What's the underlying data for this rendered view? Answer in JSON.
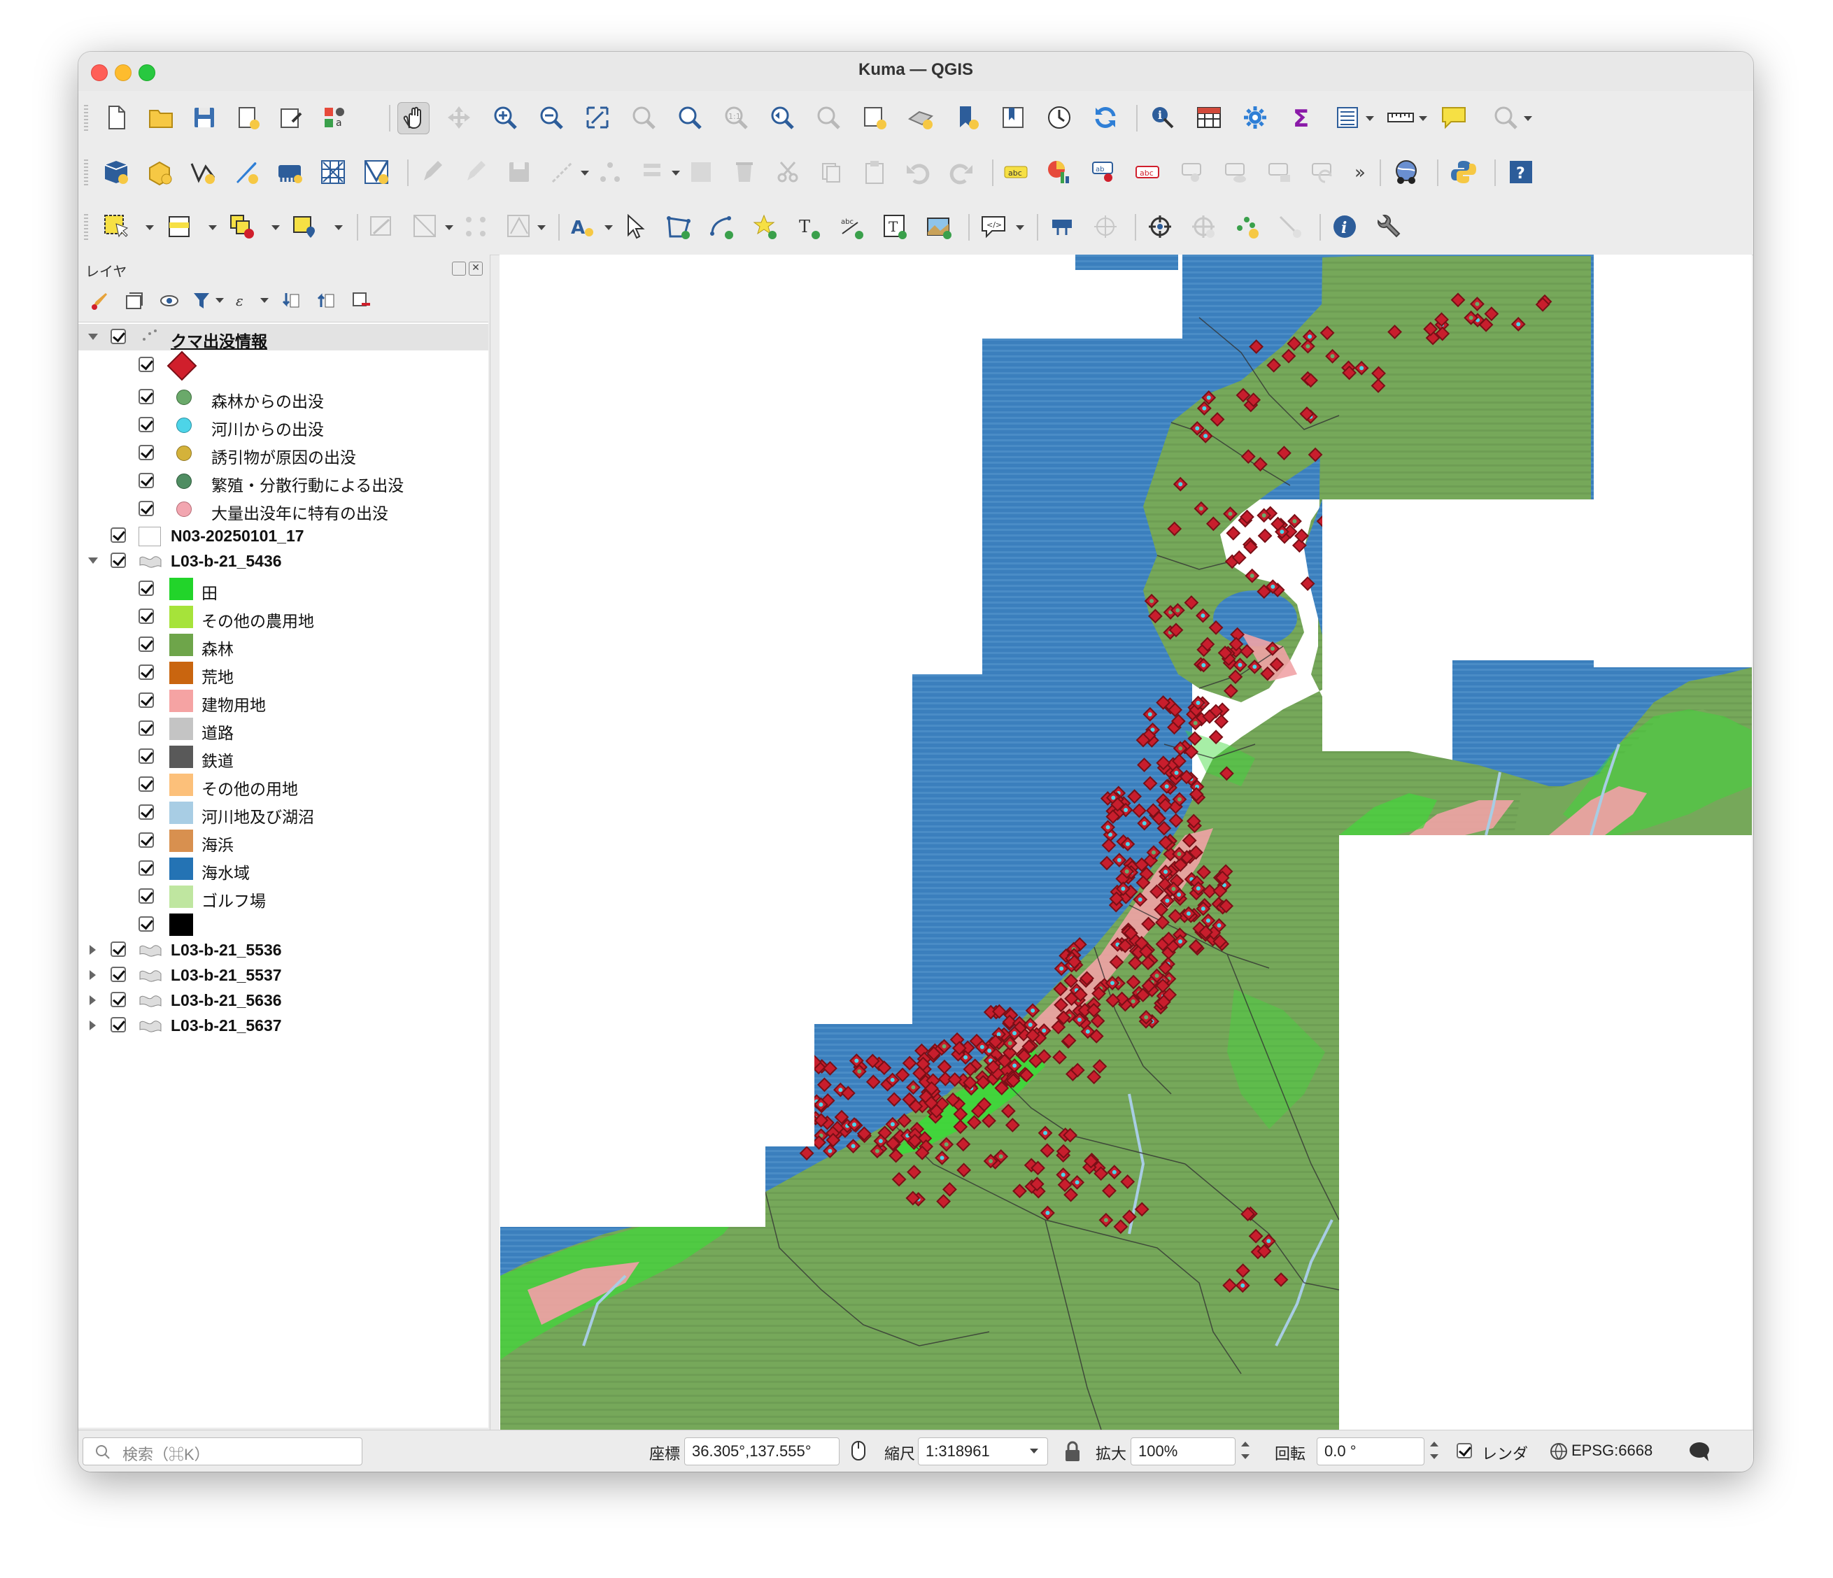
{
  "window": {
    "title": "Kuma — QGIS"
  },
  "panel": {
    "title": "レイヤ",
    "layers": [
      {
        "name": "クマ出没情報",
        "expanded": true,
        "selected": true
      },
      {
        "name": "N03-20250101_17",
        "expanded": false
      },
      {
        "name": "L03-b-21_5436",
        "expanded": true
      },
      {
        "name": "L03-b-21_5536",
        "expanded": false
      },
      {
        "name": "L03-b-21_5537",
        "expanded": false
      },
      {
        "name": "L03-b-21_5636",
        "expanded": false
      },
      {
        "name": "L03-b-21_5637",
        "expanded": false
      }
    ],
    "bear_legend": [
      {
        "label": "",
        "color": "#d01f2c",
        "shape": "diamond"
      },
      {
        "label": "森林からの出没",
        "color": "#6aa96a"
      },
      {
        "label": "河川からの出没",
        "color": "#4dd4e8"
      },
      {
        "label": "誘引物が原因の出没",
        "color": "#d4b23a"
      },
      {
        "label": "繁殖・分散行動による出没",
        "color": "#4f8d62"
      },
      {
        "label": "大量出没年に特有の出没",
        "color": "#f2a6b0"
      }
    ],
    "landuse_legend": [
      {
        "label": "田",
        "color": "#22d42a"
      },
      {
        "label": "その他の農用地",
        "color": "#a6e33a"
      },
      {
        "label": "森林",
        "color": "#6ea54a"
      },
      {
        "label": "荒地",
        "color": "#c9650f"
      },
      {
        "label": "建物用地",
        "color": "#f5a3a3"
      },
      {
        "label": "道路",
        "color": "#c4c4c4"
      },
      {
        "label": "鉄道",
        "color": "#595959"
      },
      {
        "label": "その他の用地",
        "color": "#fcc07a"
      },
      {
        "label": "河川地及び湖沼",
        "color": "#a8cde4"
      },
      {
        "label": "海浜",
        "color": "#d8904f"
      },
      {
        "label": "海水域",
        "color": "#2473b4"
      },
      {
        "label": "ゴルフ場",
        "color": "#bfe6a0"
      },
      {
        "label": "",
        "color": "#000000"
      }
    ]
  },
  "map": {
    "colors": {
      "sea": "#3b7fbd",
      "forest": "#76a85a",
      "paddy": "#3ddb39",
      "urban": "#f1a3a6",
      "marker": "#c81e2d",
      "marker_edge": "#7a0f16",
      "boundary": "#333333"
    }
  },
  "status": {
    "search_placeholder": "検索（⌘K）",
    "coord_label": "座標",
    "coord_value": "36.305°,137.555°",
    "scale_label": "縮尺",
    "scale_value": "1:318961",
    "magnifier_label": "拡大",
    "magnifier_value": "100%",
    "rotation_label": "回転",
    "rotation_value": "0.0 °",
    "render_label": "レンダ",
    "crs": "EPSG:6668"
  },
  "toolbar_overflow": "»"
}
